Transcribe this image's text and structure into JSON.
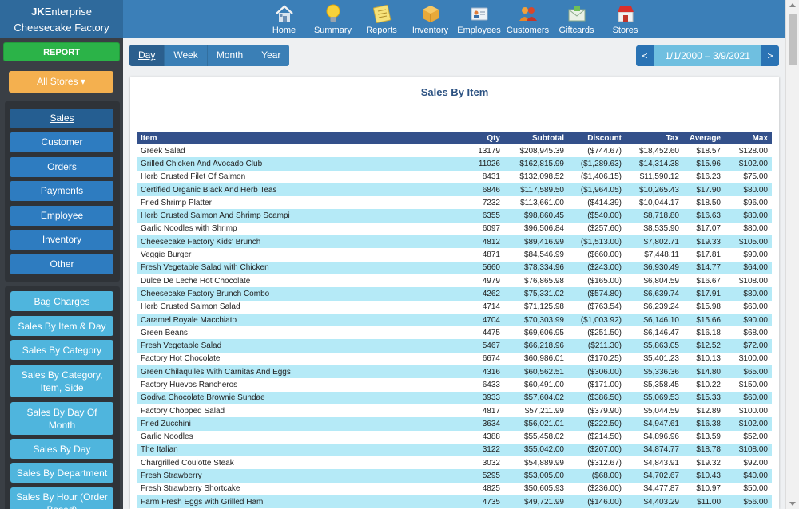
{
  "brand": {
    "company_prefix": "JK",
    "company_rest": "Enterprise",
    "location": "Cheesecake Factory"
  },
  "nav": [
    {
      "label": "Home",
      "icon": "home-icon"
    },
    {
      "label": "Summary",
      "icon": "lightbulb-icon"
    },
    {
      "label": "Reports",
      "icon": "notepad-icon"
    },
    {
      "label": "Inventory",
      "icon": "box-icon"
    },
    {
      "label": "Employees",
      "icon": "id-card-icon"
    },
    {
      "label": "Customers",
      "icon": "users-icon"
    },
    {
      "label": "Giftcards",
      "icon": "envelope-icon"
    },
    {
      "label": "Stores",
      "icon": "store-icon"
    }
  ],
  "sidebar": {
    "report_label": "REPORT",
    "stores_label": "All Stores ▾",
    "sections": [
      "Sales",
      "Customer",
      "Orders",
      "Payments",
      "Employee",
      "Inventory",
      "Other"
    ],
    "active_section": "Sales",
    "reports": [
      "Bag Charges",
      "Sales By Item & Day",
      "Sales By Category",
      "Sales By Category, Item, Side",
      "Sales By Day Of Month",
      "Sales By Day",
      "Sales By Department",
      "Sales By Hour (Order Based)"
    ]
  },
  "period": {
    "options": [
      "Day",
      "Week",
      "Month",
      "Year"
    ],
    "active": "Day"
  },
  "daterange": {
    "prev": "<",
    "next": ">",
    "text": "1/1/2000 – 3/9/2021"
  },
  "report": {
    "title": "Sales By Item",
    "columns": [
      "Item",
      "Qty",
      "Subtotal",
      "Discount",
      "Tax",
      "Average",
      "Max"
    ],
    "rows": [
      [
        "Greek Salad",
        "13179",
        "$208,945.39",
        "($744.67)",
        "$18,452.60",
        "$18.57",
        "$128.00"
      ],
      [
        "Grilled Chicken And Avocado Club",
        "11026",
        "$162,815.99",
        "($1,289.63)",
        "$14,314.38",
        "$15.96",
        "$102.00"
      ],
      [
        "Herb Crusted Filet Of Salmon",
        "8431",
        "$132,098.52",
        "($1,406.15)",
        "$11,590.12",
        "$16.23",
        "$75.00"
      ],
      [
        "Certified Organic Black And Herb Teas",
        "6846",
        "$117,589.50",
        "($1,964.05)",
        "$10,265.43",
        "$17.90",
        "$80.00"
      ],
      [
        "Fried Shrimp Platter",
        "7232",
        "$113,661.00",
        "($414.39)",
        "$10,044.17",
        "$18.50",
        "$96.00"
      ],
      [
        "Herb Crusted Salmon And Shrimp Scampi",
        "6355",
        "$98,860.45",
        "($540.00)",
        "$8,718.80",
        "$16.63",
        "$80.00"
      ],
      [
        "Garlic Noodles with Shrimp",
        "6097",
        "$96,506.84",
        "($257.60)",
        "$8,535.90",
        "$17.07",
        "$80.00"
      ],
      [
        "Cheesecake Factory Kids' Brunch",
        "4812",
        "$89,416.99",
        "($1,513.00)",
        "$7,802.71",
        "$19.33",
        "$105.00"
      ],
      [
        "Veggie Burger",
        "4871",
        "$84,546.99",
        "($660.00)",
        "$7,448.11",
        "$17.81",
        "$90.00"
      ],
      [
        "Fresh Vegetable Salad with Chicken",
        "5660",
        "$78,334.96",
        "($243.00)",
        "$6,930.49",
        "$14.77",
        "$64.00"
      ],
      [
        "Dulce De Leche Hot Chocolate",
        "4979",
        "$76,865.98",
        "($165.00)",
        "$6,804.59",
        "$16.67",
        "$108.00"
      ],
      [
        "Cheesecake Factory Brunch Combo",
        "4262",
        "$75,331.02",
        "($574.80)",
        "$6,639.74",
        "$17.91",
        "$80.00"
      ],
      [
        "Herb Crusted Salmon Salad",
        "4714",
        "$71,125.98",
        "($763.54)",
        "$6,239.24",
        "$15.98",
        "$60.00"
      ],
      [
        "Caramel Royale Macchiato",
        "4704",
        "$70,303.99",
        "($1,003.92)",
        "$6,146.10",
        "$15.66",
        "$90.00"
      ],
      [
        "Green Beans",
        "4475",
        "$69,606.95",
        "($251.50)",
        "$6,146.47",
        "$16.18",
        "$68.00"
      ],
      [
        "Fresh Vegetable Salad",
        "5467",
        "$66,218.96",
        "($211.30)",
        "$5,863.05",
        "$12.52",
        "$72.00"
      ],
      [
        "Factory Hot Chocolate",
        "6674",
        "$60,986.01",
        "($170.25)",
        "$5,401.23",
        "$10.13",
        "$100.00"
      ],
      [
        "Green Chilaquiles With Carnitas And Eggs",
        "4316",
        "$60,562.51",
        "($306.00)",
        "$5,336.36",
        "$14.80",
        "$65.00"
      ],
      [
        "Factory Huevos Rancheros",
        "6433",
        "$60,491.00",
        "($171.00)",
        "$5,358.45",
        "$10.22",
        "$150.00"
      ],
      [
        "Godiva Chocolate Brownie Sundae",
        "3933",
        "$57,604.02",
        "($386.50)",
        "$5,069.53",
        "$15.33",
        "$60.00"
      ],
      [
        "Factory Chopped Salad",
        "4817",
        "$57,211.99",
        "($379.90)",
        "$5,044.59",
        "$12.89",
        "$100.00"
      ],
      [
        "Fried Zucchini",
        "3634",
        "$56,021.01",
        "($222.50)",
        "$4,947.61",
        "$16.38",
        "$102.00"
      ],
      [
        "Garlic Noodles",
        "4388",
        "$55,458.02",
        "($214.50)",
        "$4,896.96",
        "$13.59",
        "$52.00"
      ],
      [
        "The Italian",
        "3122",
        "$55,042.00",
        "($207.00)",
        "$4,874.77",
        "$18.78",
        "$108.00"
      ],
      [
        "Chargrilled Coulotte Steak",
        "3032",
        "$54,889.99",
        "($312.67)",
        "$4,843.91",
        "$19.32",
        "$92.00"
      ],
      [
        "Fresh Strawberry",
        "5295",
        "$53,005.00",
        "($68.00)",
        "$4,702.67",
        "$10.43",
        "$40.00"
      ],
      [
        "Fresh Strawberry Shortcake",
        "4825",
        "$50,605.93",
        "($236.00)",
        "$4,477.87",
        "$10.97",
        "$50.00"
      ],
      [
        "Farm Fresh Eggs with Grilled Ham",
        "4735",
        "$49,721.99",
        "($146.00)",
        "$4,403.29",
        "$11.00",
        "$56.00"
      ]
    ]
  },
  "colors": {
    "header": "#3b7fb8",
    "sidebar": "#3a3f45",
    "report_button": "#2bb348",
    "stores_button": "#f4b04f",
    "section_button": "#2e7cc0",
    "report_link_button": "#4fb5dd",
    "table_header": "#33508a",
    "row_alt": "#b5eaf7"
  }
}
